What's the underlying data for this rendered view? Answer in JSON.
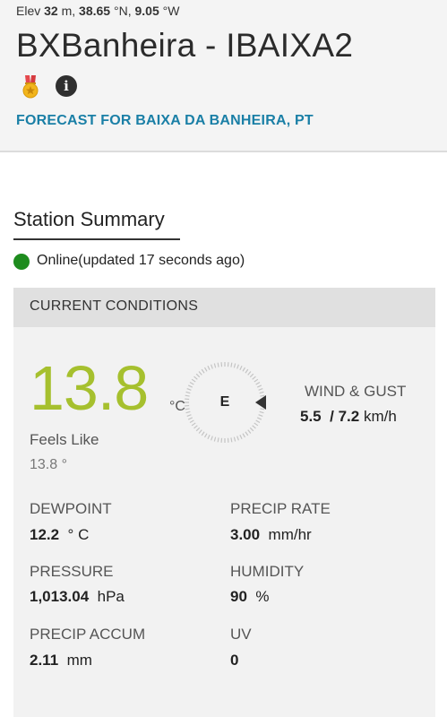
{
  "header": {
    "elev_label": "Elev",
    "elev_value": "32",
    "elev_unit": "m,",
    "latitude": "38.65",
    "lat_dir": "°N,",
    "longitude": "9.05",
    "lon_dir": "°W",
    "station_title": "BXBanheira - IBAIXA2",
    "forecast_link": "FORECAST FOR BAIXA DA BANHEIRA, PT",
    "badges": {
      "medal_icon": "medal-icon",
      "info_icon": "info-icon",
      "info_glyph": "i"
    }
  },
  "summary": {
    "heading": "Station Summary",
    "status_text": "Online(updated 17 seconds ago)",
    "status_color": "#1e8c1e"
  },
  "current_conditions": {
    "title": "CURRENT CONDITIONS",
    "temperature": "13.8",
    "temperature_unit": "°C",
    "temperature_color": "#a6c02e",
    "feels_like_label": "Feels Like",
    "feels_like_value": "13.8 °",
    "wind": {
      "direction": "E",
      "label": "WIND & GUST",
      "speed": "5.5",
      "separator": "/",
      "gust": "7.2",
      "unit": "km/h"
    },
    "stats": {
      "dewpoint": {
        "label": "DEWPOINT",
        "value": "12.2",
        "unit": "° C"
      },
      "precip_rate": {
        "label": "PRECIP RATE",
        "value": "3.00",
        "unit": "mm/hr"
      },
      "pressure": {
        "label": "PRESSURE",
        "value": "1,013.04",
        "unit": "hPa"
      },
      "humidity": {
        "label": "HUMIDITY",
        "value": "90",
        "unit": "%"
      },
      "precip_accum": {
        "label": "PRECIP ACCUM",
        "value": "2.11",
        "unit": "mm"
      },
      "uv": {
        "label": "UV",
        "value": "0",
        "unit": ""
      }
    }
  }
}
